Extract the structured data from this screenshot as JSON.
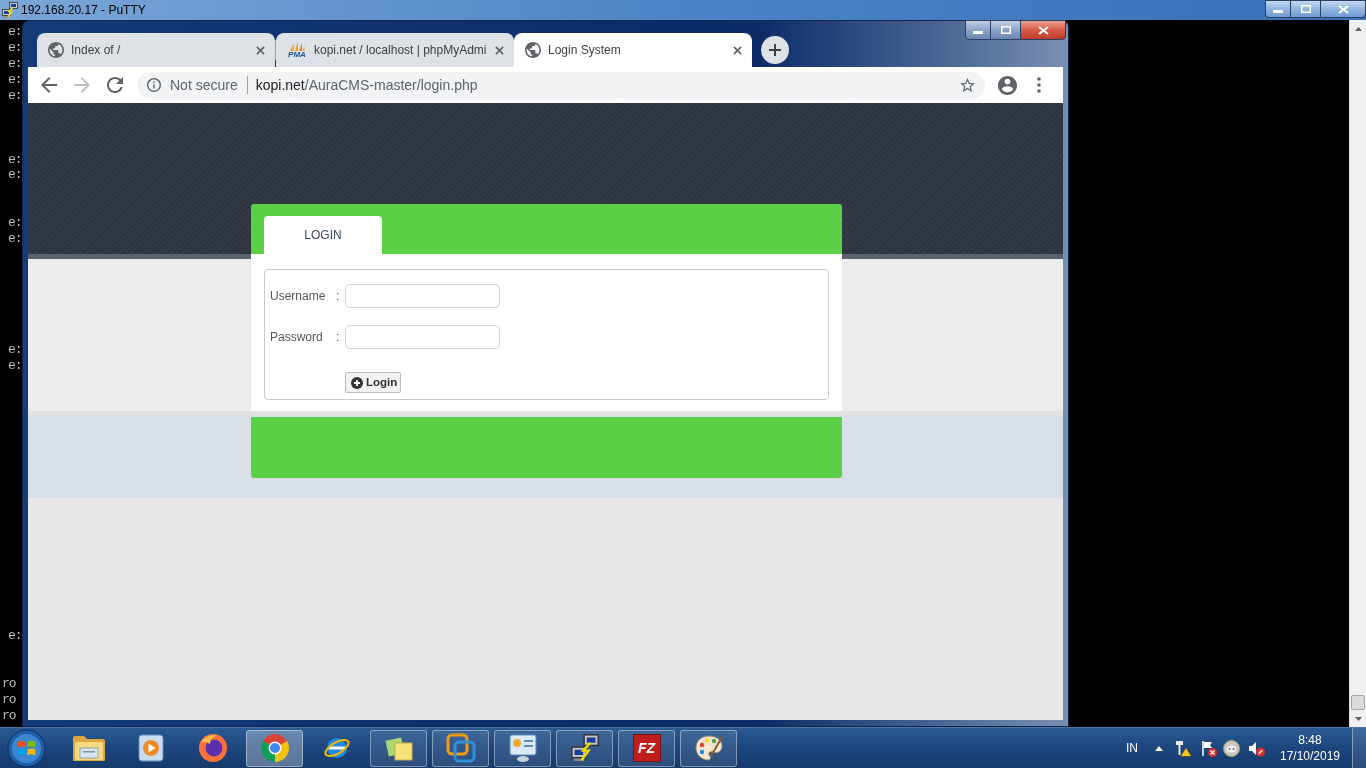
{
  "putty_window": {
    "title": "192.168.20.17 - PuTTY",
    "terminal_lines": [
      "e:",
      "e:",
      "e:",
      "e:",
      "e:",
      "e:",
      "e:",
      "e:",
      "e:",
      "e:",
      "e:",
      "e:",
      "ro",
      "ro",
      "ro"
    ]
  },
  "browser": {
    "tabs": [
      {
        "title": "Index of /",
        "selected": false
      },
      {
        "title": "kopi.net / localhost | phpMyAdmi",
        "selected": false,
        "favicon_text": "PMA"
      },
      {
        "title": "Login System",
        "selected": true
      }
    ],
    "navigation": {
      "back": {
        "disabled": false
      },
      "forward": {
        "disabled": true
      }
    },
    "address_bar": {
      "security_label": "Not secure",
      "host": "kopi.net",
      "path": "/AuraCMS-master/login.php"
    }
  },
  "page": {
    "tabs": [
      {
        "label": "LOGIN",
        "selected": true
      }
    ],
    "fields": [
      {
        "label": "Username",
        "separator": ":"
      },
      {
        "label": "Password",
        "separator": ":"
      }
    ],
    "submit_button": "Login"
  },
  "taskbar": {
    "buttons": [
      {
        "running": false,
        "selected": false
      },
      {
        "running": false,
        "selected": false
      },
      {
        "running": false,
        "selected": false
      },
      {
        "running": true,
        "selected": true
      },
      {
        "running": false,
        "selected": false
      },
      {
        "running": true,
        "selected": false
      },
      {
        "running": true,
        "selected": false
      },
      {
        "running": true,
        "selected": false
      },
      {
        "running": true,
        "selected": false
      },
      {
        "running": true,
        "selected": false,
        "logo_text": "FZ"
      },
      {
        "running": true,
        "selected": false
      }
    ],
    "language": "IN",
    "clock": {
      "time": "8:48",
      "date": "17/10/2019"
    }
  }
}
